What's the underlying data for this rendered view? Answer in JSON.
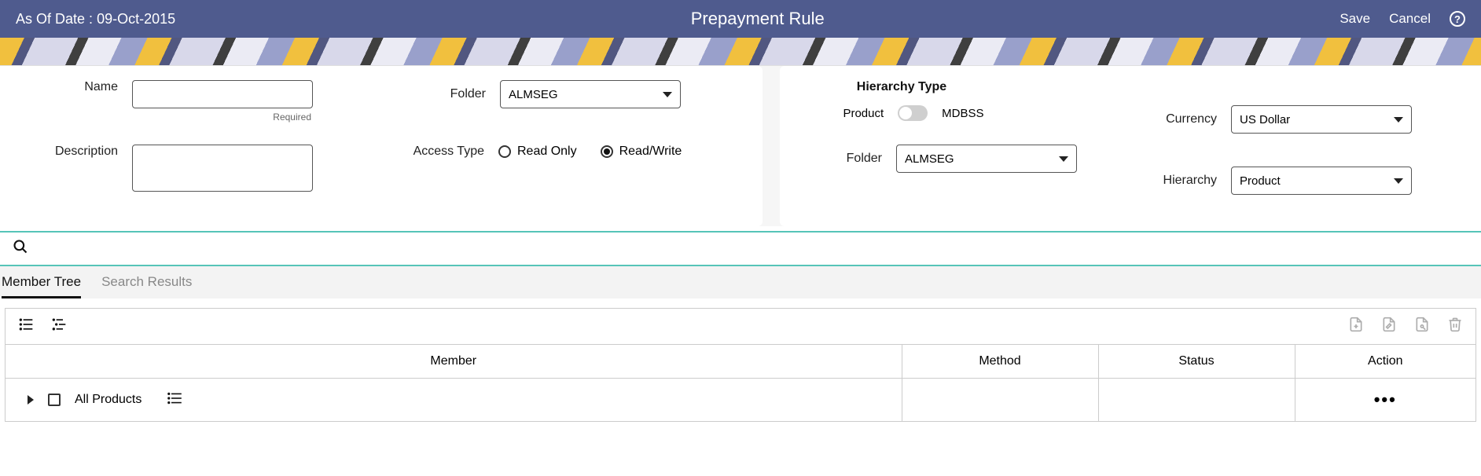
{
  "header": {
    "as_of_label": "As Of Date :",
    "as_of_value": "09-Oct-2015",
    "title": "Prepayment Rule",
    "save": "Save",
    "cancel": "Cancel"
  },
  "left_panel": {
    "name_label": "Name",
    "name_value": "",
    "name_required": "Required",
    "description_label": "Description",
    "description_value": "",
    "folder_label": "Folder",
    "folder_value": "ALMSEG",
    "access_type_label": "Access Type",
    "access_read_only": "Read Only",
    "access_read_write": "Read/Write",
    "access_selected": "read_write"
  },
  "right_panel": {
    "hierarchy_type_label": "Hierarchy Type",
    "toggle_left": "Product",
    "toggle_right": "MDBSS",
    "currency_label": "Currency",
    "currency_value": "US Dollar",
    "folder_label": "Folder",
    "folder_value": "ALMSEG",
    "hierarchy_label": "Hierarchy",
    "hierarchy_value": "Product"
  },
  "tabs": {
    "member_tree": "Member Tree",
    "search_results": "Search Results"
  },
  "table": {
    "headers": {
      "member": "Member",
      "method": "Method",
      "status": "Status",
      "action": "Action"
    },
    "rows": [
      {
        "member": "All Products",
        "method": "",
        "status": "",
        "action": "..."
      }
    ]
  }
}
